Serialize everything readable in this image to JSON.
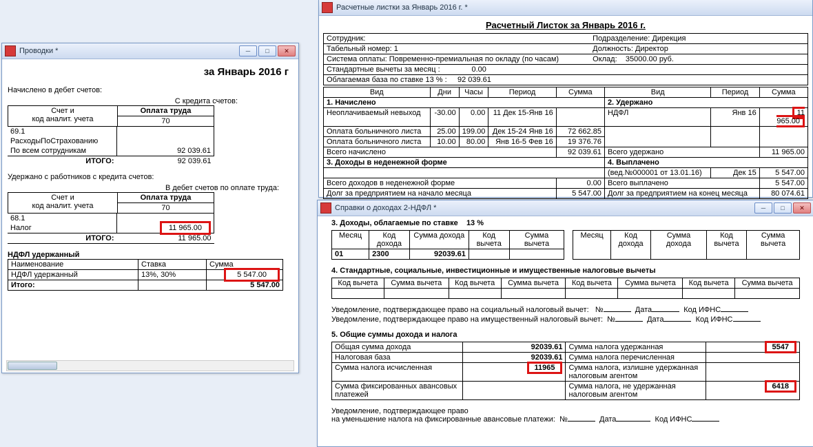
{
  "win1": {
    "title": "Проводки *",
    "heading": "за Январь 2016 г",
    "s1": "Начислено в дебет счетов:",
    "s2": "С кредита счетов:",
    "h_account": "Счет и\nкод аналит. учета",
    "h_labor": "Оплата труда",
    "h_labor_code": "70",
    "row1_code": "69.1",
    "row1_name": "РасходыПоСтрахованию",
    "row2_name": "По всем сотрудникам",
    "row2_val": "92 039.61",
    "itogo": "ИТОГО:",
    "itogo_val": "92 039.61",
    "s3": "Удержано с работников с кредита счетов:",
    "s4": "В дебет счетов по оплате труда:",
    "row3_code": "68.1",
    "row3_name": "Налог",
    "row3_val": "11 965.00",
    "itogo2_val": "11 965.00",
    "s5": "НДФЛ удержанный",
    "h_name": "Наименование",
    "h_rate": "Ставка",
    "h_sum": "Сумма",
    "row4_name": "НДФЛ удержанный",
    "row4_rate": "13%, 30%",
    "row4_val": "5 547.00",
    "row5_name": "Итого:",
    "row5_val": "5 547.00"
  },
  "win2": {
    "title": "Расчетные листки за Январь 2016 г. *",
    "heading": "Расчетный Листок за Январь 2016 г.",
    "l_emp": "Сотрудник:",
    "l_div": "Подразделение:",
    "v_div": "Дирекция",
    "l_tab": "Табельный номер:",
    "v_tab": "1",
    "l_pos": "Должность:",
    "v_pos": "Директор",
    "l_sys": "Система оплаты:",
    "v_sys": "Повременно-премиальная по окладу (по часам)",
    "l_okl": "Оклад:",
    "v_okl": "35000.00 руб.",
    "l_std": "Стандартные вычеты за месяц :",
    "v_std": "0.00",
    "l_base": "Облагаемая база по ставке 13 % :",
    "v_base": "92 039.61",
    "h_vid": "Вид",
    "h_dni": "Дни",
    "h_ch": "Часы",
    "h_per": "Период",
    "h_sum": "Сумма",
    "s_nach": "1. Начислено",
    "s_uder": "2. Удержано",
    "n1": "Неоплачиваемый невыход",
    "n1d": "-30.00",
    "n1c": "0.00",
    "n1p": "11 Дек 15-Янв 16",
    "u1": "НДФЛ",
    "u1p": "Янв 16",
    "u1s": "11 965.00",
    "n2": "Оплата больничного листа",
    "n2d": "25.00",
    "n2c": "199.00",
    "n2p": "Дек 15-24 Янв 16",
    "n2s": "72 662.85",
    "n3": "Оплата больничного листа",
    "n3d": "10.00",
    "n3c": "80.00",
    "n3p": "Янв 16-5 Фев 16",
    "n3s": "19 376.76",
    "n_tot": "Всего начислено",
    "n_tot_s": "92 039.61",
    "u_tot": "Всего удержано",
    "u_tot_s": "11 965.00",
    "s_doh": "3. Доходы в неденежной форме",
    "s_vyp": "4. Выплачено",
    "v1": "(вед.№000001 от 13.01.16)",
    "v1p": "Дек 15",
    "v1s": "5 547.00",
    "d_tot": "Всего доходов в неденежной форме",
    "d_tot_s": "0.00",
    "v_tot": "Всего выплачено",
    "v_tot_s": "5 547.00",
    "dolg1": "Долг за предприятием на начало месяца",
    "dolg1s": "5 547.00",
    "dolg2": "Долг за предприятием  на конец месяца",
    "dolg2s": "80 074.61"
  },
  "win3": {
    "title": "Справки о доходах 2-НДФЛ *",
    "s3": "3. Доходы, облагаемые по ставке",
    "s3r": "13    %",
    "h_month": "Месяц",
    "h_kd": "Код дохода",
    "h_sd": "Сумма дохода",
    "h_kv": "Код вычета",
    "h_sv": "Сумма вычета",
    "r_m": "01",
    "r_kd": "2300",
    "r_sd": "92039.61",
    "s4": "4. Стандартные, социальные, инвестиционные и имущественные налоговые вычеты",
    "not1": "Уведомление, подтверждающее право на социальный налоговый вычет:",
    "not2": "Уведомление, подтверждающее право на имущественный налоговый вычет:",
    "lbl_no": "№",
    "lbl_date": "Дата",
    "lbl_ifns": "Код ИФНС",
    "s5": "5. Общие суммы дохода и налога",
    "r1a": "Общая сумма дохода",
    "r1av": "92039.61",
    "r1b": "Сумма налога удержанная",
    "r1bv": "5547",
    "r2a": "Налоговая база",
    "r2av": "92039.61",
    "r2b": "Сумма налога перечисленная",
    "r3a": "Сумма налога исчисленная",
    "r3av": "11965",
    "r3b": "Сумма налога, излишне удержанная налоговым агентом",
    "r4a": "Сумма фиксированных авансовых платежей",
    "r4b": "Сумма налога, не удержанная налоговым агентом",
    "r4bv": "6418",
    "not3": "Уведомление, подтверждающее право",
    "not3b": "на уменьшение налога на фиксированные авансовые платежи:"
  }
}
